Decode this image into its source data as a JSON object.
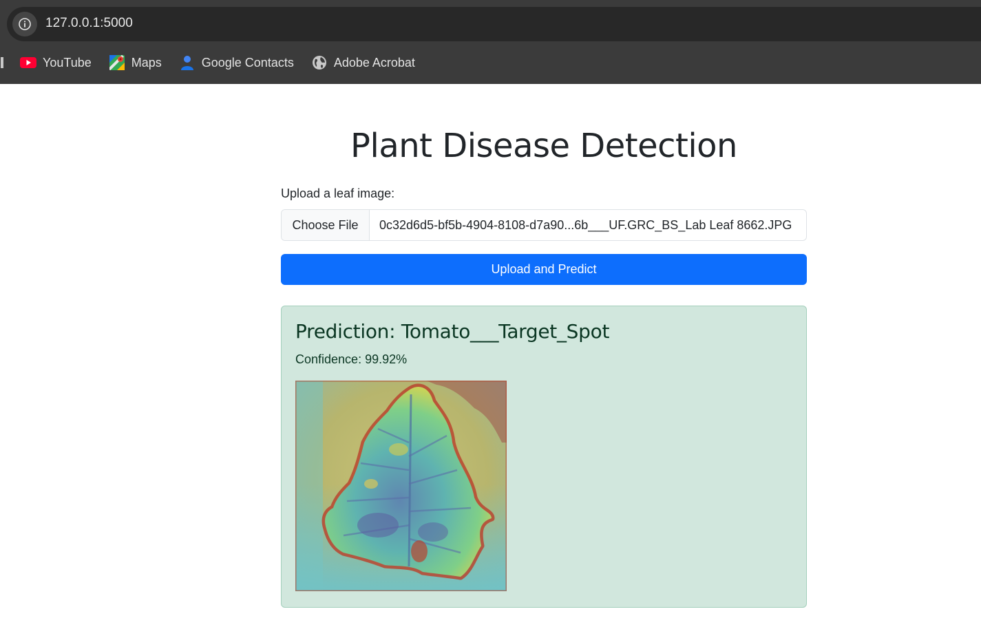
{
  "browser": {
    "url": "127.0.0.1:5000",
    "bookmarks": [
      {
        "label": "YouTube",
        "icon": "youtube-icon"
      },
      {
        "label": "Maps",
        "icon": "maps-icon"
      },
      {
        "label": "Google Contacts",
        "icon": "contacts-icon"
      },
      {
        "label": "Adobe Acrobat",
        "icon": "globe-icon"
      }
    ]
  },
  "page": {
    "title": "Plant Disease Detection",
    "upload_label": "Upload a leaf image:",
    "choose_file_label": "Choose File",
    "file_name": "0c32d6d5-bf5b-4904-8108-d7a90...6b___UF.GRC_BS_Lab Leaf 8662.JPG",
    "submit_label": "Upload and Predict"
  },
  "result": {
    "prediction": "Prediction: Tomato___Target_Spot",
    "confidence": "Confidence: 99.92%"
  },
  "colors": {
    "primary": "#0d6efd",
    "success_bg": "#d1e7dd",
    "success_border": "#a3cfbb",
    "success_text": "#0a3622"
  }
}
